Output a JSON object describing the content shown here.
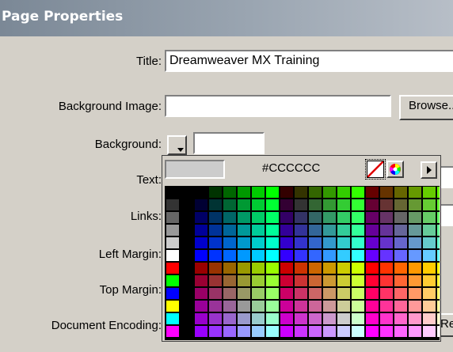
{
  "dialog": {
    "title": "Page Properties"
  },
  "fields": {
    "title_label": "Title:",
    "title_value": "Dreamweaver MX Training",
    "bg_image_label": "Background Image:",
    "bg_image_value": "",
    "browse_label": "Browse...",
    "background_label": "Background:",
    "background_value": "",
    "text_label": "Text:",
    "links_label": "Links:",
    "left_margin_label": "Left Margin:",
    "top_margin_label": "Top Margin:",
    "doc_encoding_label": "Document Encoding:",
    "reload_label": "Reload"
  },
  "color_picker": {
    "hex_value": "#CCCCCC",
    "preview_color": "#CCCCCC",
    "icons": [
      "no-color-icon",
      "color-wheel-icon",
      "menu-arrow-icon"
    ],
    "palette": "web-safe-216",
    "extra_column": [
      "#FF0000",
      "#00FF00",
      "#0000FF",
      "#FFFF00",
      "#00FFFF",
      "#FF00FF"
    ]
  }
}
